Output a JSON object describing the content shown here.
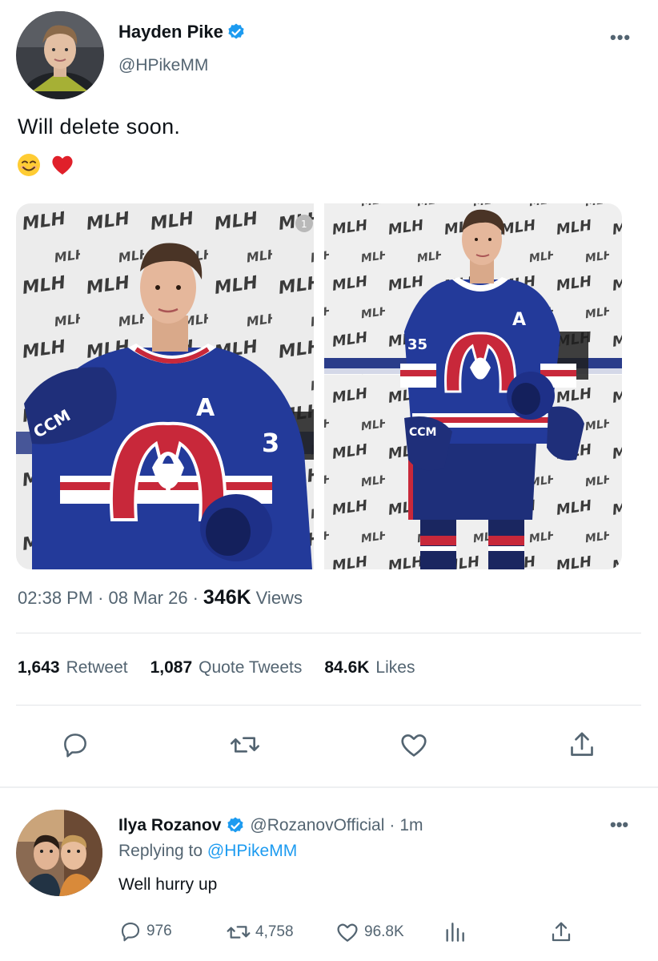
{
  "tweet": {
    "author": {
      "name": "Hayden Pike",
      "handle": "@HPikeMM",
      "verified": true
    },
    "more_label": "•••",
    "text": "Will delete soon.",
    "emojis": [
      "smiling-face-emoji",
      "red-heart-emoji"
    ],
    "media": {
      "count": 2,
      "photo_badge": "1",
      "left_photo": {
        "jersey_letter": "A",
        "jersey_number": "3",
        "glove_brand": "CCM",
        "backdrop_logo": "MLH"
      },
      "right_photo": {
        "jersey_letter": "A",
        "jersey_number": "35",
        "glove_brand": "CCM",
        "backdrop_logo": "MLH"
      }
    },
    "meta": {
      "time": "02:38 PM",
      "dot1": "·",
      "date": "08 Mar 26",
      "dot2": "·",
      "views_count": "346K",
      "views_label": "Views"
    },
    "stats": {
      "retweets_count": "1,643",
      "retweets_label": "Retweet",
      "quotes_count": "1,087",
      "quotes_label": "Quote Tweets",
      "likes_count": "84.6K",
      "likes_label": "Likes"
    },
    "actions": [
      "reply-icon",
      "retweet-icon",
      "like-icon",
      "share-icon"
    ]
  },
  "reply": {
    "author": {
      "name": "Ilya Rozanov",
      "handle": "@RozanovOfficial",
      "verified": true
    },
    "separator": "·",
    "time": "1m",
    "more_label": "•••",
    "replying_prefix": "Replying to",
    "replying_handle": "@HPikeMM",
    "text": "Well hurry up",
    "counts": {
      "replies": "976",
      "retweets": "4,758",
      "likes": "96.8K"
    },
    "actions": [
      "reply-icon",
      "retweet-icon",
      "like-icon",
      "views-icon",
      "share-icon"
    ]
  },
  "colors": {
    "accent": "#1d9bf0",
    "secondary_text": "#536471",
    "jersey_blue": "#233a9a",
    "jersey_red": "#c8283a"
  }
}
